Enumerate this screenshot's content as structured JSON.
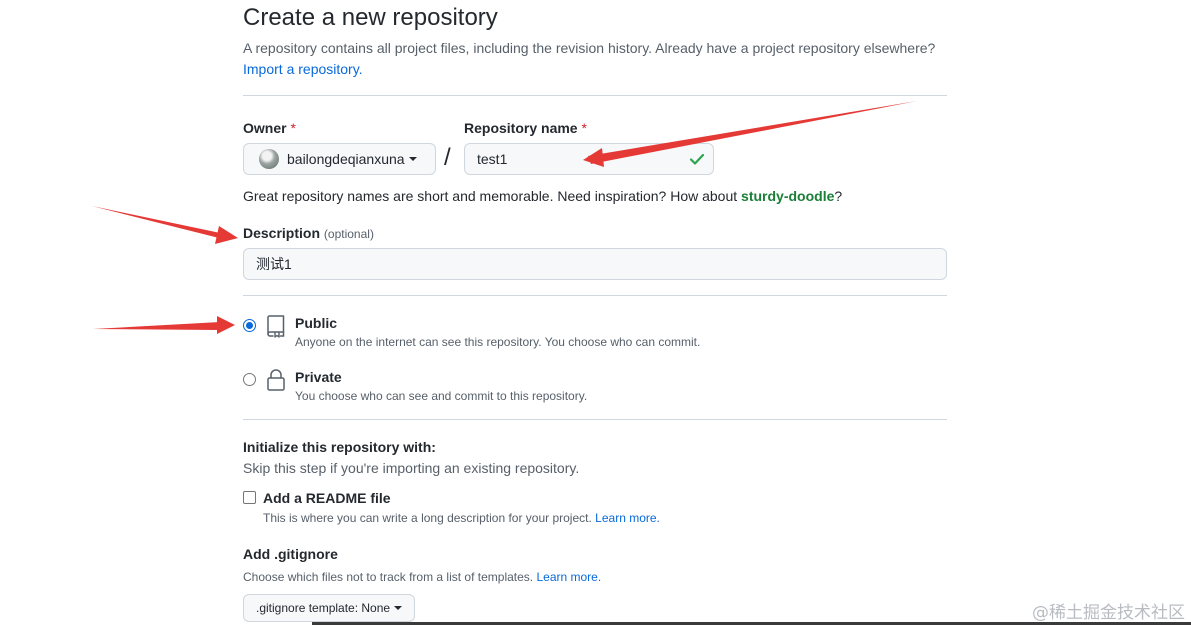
{
  "header": {
    "title": "Create a new repository",
    "subtitle": "A repository contains all project files, including the revision history. Already have a project repository elsewhere?",
    "import_link": "Import a repository."
  },
  "owner": {
    "label": "Owner",
    "required_mark": "*",
    "value": "bailongdeqianxuna"
  },
  "repo_name": {
    "label": "Repository name",
    "required_mark": "*",
    "value": "test1",
    "separator": "/",
    "hint_prefix": "Great repository names are short and memorable. Need inspiration? How about",
    "suggestion": "sturdy-doodle",
    "hint_suffix": "?"
  },
  "description": {
    "label": "Description",
    "optional": "(optional)",
    "value": "测试1"
  },
  "visibility": {
    "public": {
      "title": "Public",
      "desc": "Anyone on the internet can see this repository. You choose who can commit.",
      "selected": true
    },
    "private": {
      "title": "Private",
      "desc": "You choose who can see and commit to this repository.",
      "selected": false
    }
  },
  "initialize": {
    "title": "Initialize this repository with:",
    "subtitle": "Skip this step if you're importing an existing repository.",
    "readme_label": "Add a README file",
    "readme_desc": "This is where you can write a long description for your project.",
    "learn_more": "Learn more."
  },
  "gitignore": {
    "title": "Add .gitignore",
    "desc": "Choose which files not to track from a list of templates.",
    "learn_more": "Learn more.",
    "select_label": ".gitignore template: None"
  },
  "watermark": "@稀土掘金技术社区",
  "colors": {
    "link": "#0969da",
    "required": "#cf222e",
    "success": "#1a7f37",
    "annotation_arrow": "#e53935"
  }
}
